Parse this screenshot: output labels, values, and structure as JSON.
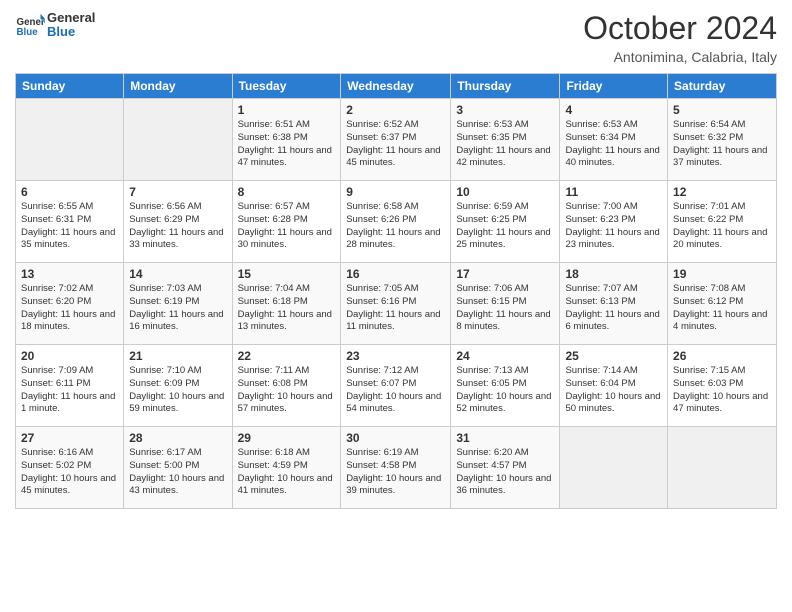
{
  "logo": {
    "line1": "General",
    "line2": "Blue"
  },
  "title": "October 2024",
  "location": "Antonimina, Calabria, Italy",
  "weekdays": [
    "Sunday",
    "Monday",
    "Tuesday",
    "Wednesday",
    "Thursday",
    "Friday",
    "Saturday"
  ],
  "weeks": [
    [
      {
        "day": "",
        "info": ""
      },
      {
        "day": "",
        "info": ""
      },
      {
        "day": "1",
        "info": "Sunrise: 6:51 AM\nSunset: 6:38 PM\nDaylight: 11 hours and 47 minutes."
      },
      {
        "day": "2",
        "info": "Sunrise: 6:52 AM\nSunset: 6:37 PM\nDaylight: 11 hours and 45 minutes."
      },
      {
        "day": "3",
        "info": "Sunrise: 6:53 AM\nSunset: 6:35 PM\nDaylight: 11 hours and 42 minutes."
      },
      {
        "day": "4",
        "info": "Sunrise: 6:53 AM\nSunset: 6:34 PM\nDaylight: 11 hours and 40 minutes."
      },
      {
        "day": "5",
        "info": "Sunrise: 6:54 AM\nSunset: 6:32 PM\nDaylight: 11 hours and 37 minutes."
      }
    ],
    [
      {
        "day": "6",
        "info": "Sunrise: 6:55 AM\nSunset: 6:31 PM\nDaylight: 11 hours and 35 minutes."
      },
      {
        "day": "7",
        "info": "Sunrise: 6:56 AM\nSunset: 6:29 PM\nDaylight: 11 hours and 33 minutes."
      },
      {
        "day": "8",
        "info": "Sunrise: 6:57 AM\nSunset: 6:28 PM\nDaylight: 11 hours and 30 minutes."
      },
      {
        "day": "9",
        "info": "Sunrise: 6:58 AM\nSunset: 6:26 PM\nDaylight: 11 hours and 28 minutes."
      },
      {
        "day": "10",
        "info": "Sunrise: 6:59 AM\nSunset: 6:25 PM\nDaylight: 11 hours and 25 minutes."
      },
      {
        "day": "11",
        "info": "Sunrise: 7:00 AM\nSunset: 6:23 PM\nDaylight: 11 hours and 23 minutes."
      },
      {
        "day": "12",
        "info": "Sunrise: 7:01 AM\nSunset: 6:22 PM\nDaylight: 11 hours and 20 minutes."
      }
    ],
    [
      {
        "day": "13",
        "info": "Sunrise: 7:02 AM\nSunset: 6:20 PM\nDaylight: 11 hours and 18 minutes."
      },
      {
        "day": "14",
        "info": "Sunrise: 7:03 AM\nSunset: 6:19 PM\nDaylight: 11 hours and 16 minutes."
      },
      {
        "day": "15",
        "info": "Sunrise: 7:04 AM\nSunset: 6:18 PM\nDaylight: 11 hours and 13 minutes."
      },
      {
        "day": "16",
        "info": "Sunrise: 7:05 AM\nSunset: 6:16 PM\nDaylight: 11 hours and 11 minutes."
      },
      {
        "day": "17",
        "info": "Sunrise: 7:06 AM\nSunset: 6:15 PM\nDaylight: 11 hours and 8 minutes."
      },
      {
        "day": "18",
        "info": "Sunrise: 7:07 AM\nSunset: 6:13 PM\nDaylight: 11 hours and 6 minutes."
      },
      {
        "day": "19",
        "info": "Sunrise: 7:08 AM\nSunset: 6:12 PM\nDaylight: 11 hours and 4 minutes."
      }
    ],
    [
      {
        "day": "20",
        "info": "Sunrise: 7:09 AM\nSunset: 6:11 PM\nDaylight: 11 hours and 1 minute."
      },
      {
        "day": "21",
        "info": "Sunrise: 7:10 AM\nSunset: 6:09 PM\nDaylight: 10 hours and 59 minutes."
      },
      {
        "day": "22",
        "info": "Sunrise: 7:11 AM\nSunset: 6:08 PM\nDaylight: 10 hours and 57 minutes."
      },
      {
        "day": "23",
        "info": "Sunrise: 7:12 AM\nSunset: 6:07 PM\nDaylight: 10 hours and 54 minutes."
      },
      {
        "day": "24",
        "info": "Sunrise: 7:13 AM\nSunset: 6:05 PM\nDaylight: 10 hours and 52 minutes."
      },
      {
        "day": "25",
        "info": "Sunrise: 7:14 AM\nSunset: 6:04 PM\nDaylight: 10 hours and 50 minutes."
      },
      {
        "day": "26",
        "info": "Sunrise: 7:15 AM\nSunset: 6:03 PM\nDaylight: 10 hours and 47 minutes."
      }
    ],
    [
      {
        "day": "27",
        "info": "Sunrise: 6:16 AM\nSunset: 5:02 PM\nDaylight: 10 hours and 45 minutes."
      },
      {
        "day": "28",
        "info": "Sunrise: 6:17 AM\nSunset: 5:00 PM\nDaylight: 10 hours and 43 minutes."
      },
      {
        "day": "29",
        "info": "Sunrise: 6:18 AM\nSunset: 4:59 PM\nDaylight: 10 hours and 41 minutes."
      },
      {
        "day": "30",
        "info": "Sunrise: 6:19 AM\nSunset: 4:58 PM\nDaylight: 10 hours and 39 minutes."
      },
      {
        "day": "31",
        "info": "Sunrise: 6:20 AM\nSunset: 4:57 PM\nDaylight: 10 hours and 36 minutes."
      },
      {
        "day": "",
        "info": ""
      },
      {
        "day": "",
        "info": ""
      }
    ]
  ]
}
